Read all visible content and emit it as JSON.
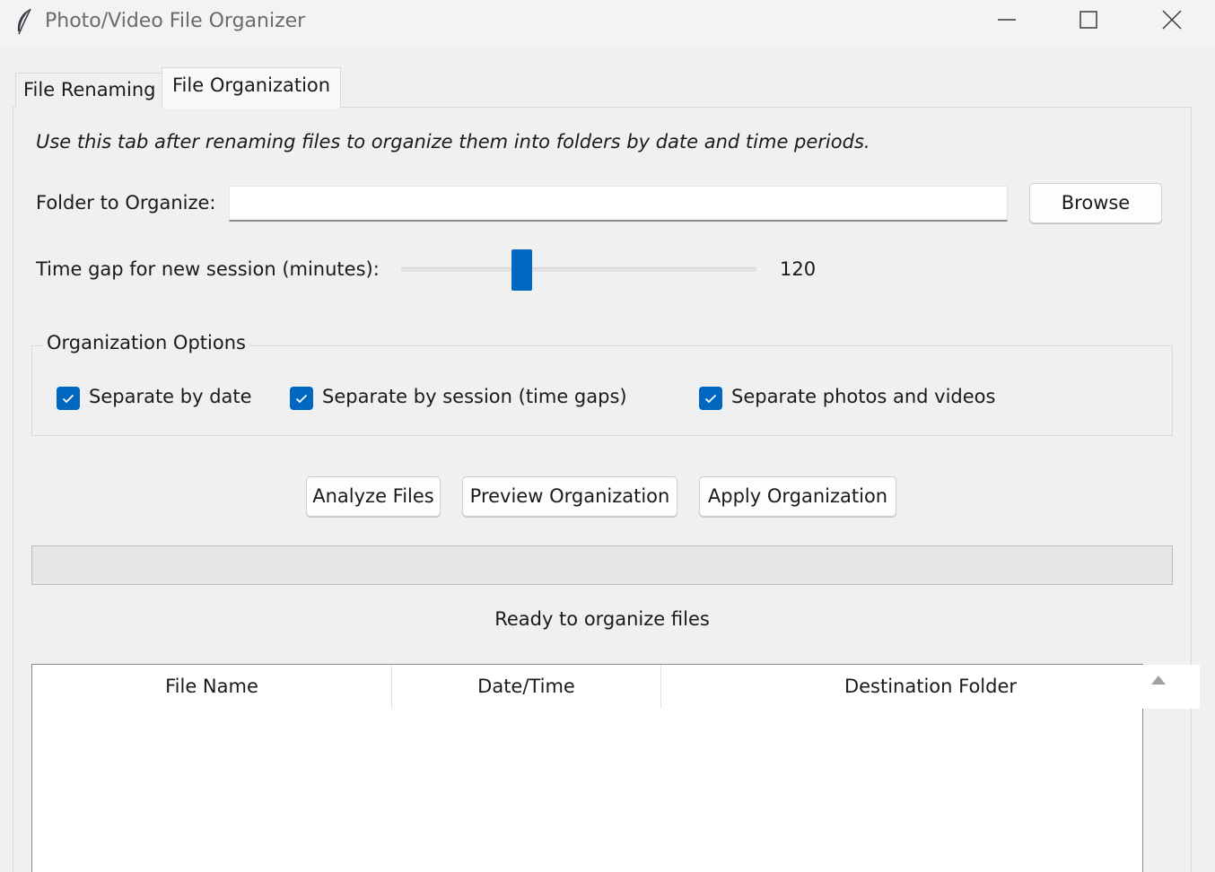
{
  "window": {
    "title": "Photo/Video File Organizer",
    "app_icon": "feather-icon",
    "controls": [
      "minimize-icon",
      "maximize-icon",
      "close-icon"
    ]
  },
  "tabs": [
    {
      "label": "File Renaming",
      "active": false
    },
    {
      "label": "File Organization",
      "active": true
    }
  ],
  "organization": {
    "description": "Use this tab after renaming files to organize them into folders by date and time periods.",
    "folder_label": "Folder to Organize:",
    "folder_value": "",
    "browse_label": "Browse",
    "time_gap_label": "Time gap for new session (minutes):",
    "time_gap_value": "120",
    "options_title": "Organization Options",
    "options": [
      {
        "label": "Separate by date",
        "checked": true
      },
      {
        "label": "Separate by session (time gaps)",
        "checked": true
      },
      {
        "label": "Separate photos and videos",
        "checked": true
      }
    ],
    "buttons": {
      "analyze": "Analyze Files",
      "preview": "Preview Organization",
      "apply": "Apply Organization"
    },
    "progress": 0,
    "status": "Ready to organize files",
    "table": {
      "columns": [
        "File Name",
        "Date/Time",
        "Destination Folder"
      ],
      "rows": []
    }
  },
  "colors": {
    "accent": "#0067c0",
    "background": "#f0f0f0"
  }
}
